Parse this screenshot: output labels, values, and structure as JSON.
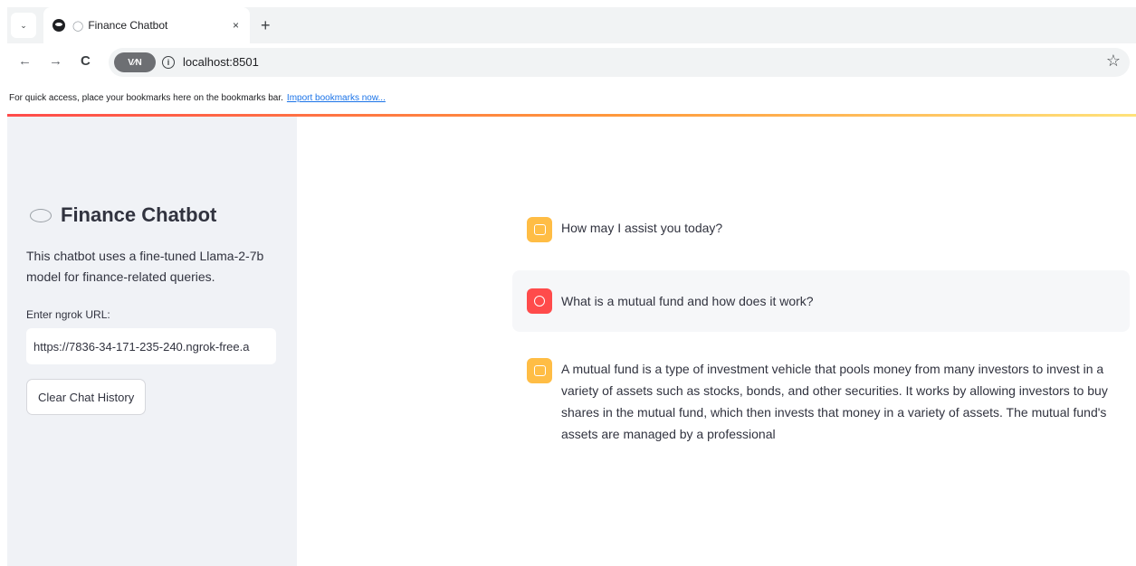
{
  "browser": {
    "tab_menu_icon": "⌄",
    "tab": {
      "title": "Finance Chatbot",
      "close": "×"
    },
    "new_tab": "+",
    "nav": {
      "back": "←",
      "forward": "→",
      "reload": "C"
    },
    "vpn_label": "V⁄N",
    "info_icon": "i",
    "url": "localhost:8501",
    "star_icon": "☆",
    "bookmarks_bar": {
      "text": "For quick access, place your bookmarks here on the bookmarks bar.",
      "link": "Import bookmarks now..."
    }
  },
  "sidebar": {
    "title": "Finance Chatbot",
    "description": "This chatbot uses a fine-tuned Llama-2-7b model for finance-related queries.",
    "url_label": "Enter ngrok URL:",
    "url_value": "https://7836-34-171-235-240.ngrok-free.a",
    "clear_button": "Clear Chat History"
  },
  "chat": {
    "messages": [
      {
        "role": "assistant",
        "text": "How may I assist you today?"
      },
      {
        "role": "user",
        "text": "What is a mutual fund and how does it work?"
      },
      {
        "role": "assistant",
        "text": "A mutual fund is a type of investment vehicle that pools money from many investors to invest in a variety of assets such as stocks, bonds, and other securities. It works by allowing investors to buy shares in the mutual fund, which then invests that money in a variety of assets. The mutual fund's assets are managed by a professional"
      }
    ]
  },
  "colors": {
    "assistant_avatar": "#ffbd45",
    "user_avatar": "#ff4b4b",
    "sidebar_bg": "#f0f2f6"
  }
}
